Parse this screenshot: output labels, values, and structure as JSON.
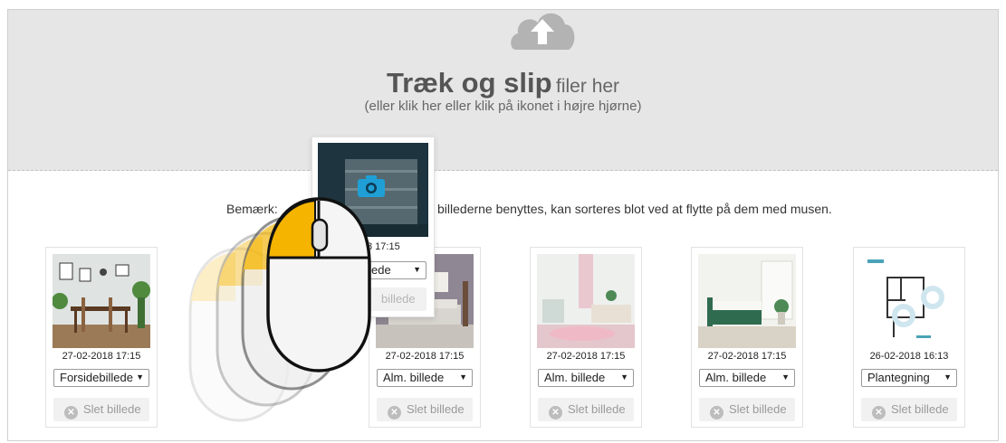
{
  "dropzone": {
    "title_strong": "Træk og slip",
    "title_light": "filer her",
    "subtitle": "(eller klik her eller klik på ikonet i højre hjørne)",
    "icon": "cloud-upload-icon"
  },
  "note": {
    "part1": "Bemærk:",
    "part2": "billederne benyttes, kan sorteres blot ved at flytte på dem med musen."
  },
  "dragged_card": {
    "date": "8 17:15",
    "select_value": "ede",
    "delete_label": "billede",
    "icon": "camera-icon"
  },
  "cards": [
    {
      "date": "27-02-2018 17:15",
      "select_value": "Forsidebillede",
      "delete_label": "Slet billede",
      "image": "dining-room-photo"
    },
    {
      "date": "27-02-2018 17:15",
      "select_value": "Alm. billede",
      "delete_label": "Slet billede",
      "image": "living-room-photo"
    },
    {
      "date": "27-02-2018 17:15",
      "select_value": "Alm. billede",
      "delete_label": "Slet billede",
      "image": "pink-living-room-photo"
    },
    {
      "date": "27-02-2018 17:15",
      "select_value": "Alm. billede",
      "delete_label": "Slet billede",
      "image": "bedroom-photo"
    },
    {
      "date": "26-02-2018 16:13",
      "select_value": "Plantegning",
      "delete_label": "Slet billede",
      "image": "floor-plan-image"
    }
  ],
  "colors": {
    "dropzone_bg": "#e6e6e6",
    "mouse_accent": "#f4b400",
    "text": "#555555"
  }
}
